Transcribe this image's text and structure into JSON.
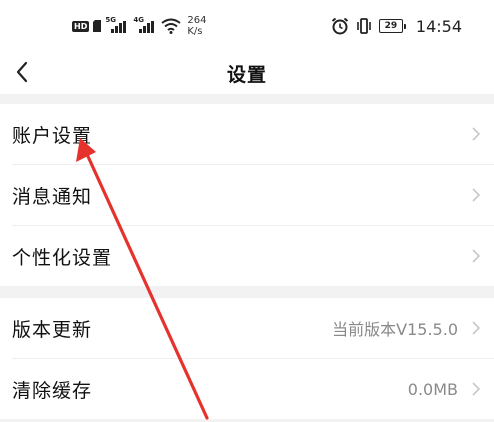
{
  "status_bar": {
    "hd_badge": "HD",
    "net1_label": "5G",
    "net2_label": "4G",
    "speed_value": "264",
    "speed_unit": "K/s",
    "battery_level": "29",
    "time": "14:54"
  },
  "header": {
    "title": "设置"
  },
  "settings": {
    "items": [
      {
        "label": "账户设置",
        "value": ""
      },
      {
        "label": "消息通知",
        "value": ""
      },
      {
        "label": "个性化设置",
        "value": ""
      },
      {
        "label": "版本更新",
        "value": "当前版本V15.5.0"
      },
      {
        "label": "清除缓存",
        "value": "0.0MB"
      }
    ]
  },
  "colors": {
    "background": "#ffffff",
    "section_gap": "#f2f2f2",
    "text_primary": "#111111",
    "text_secondary": "#8a8a8a",
    "chevron": "#c8c8c8",
    "annotation_arrow": "#e5322d"
  },
  "icons": {
    "back": "chevron-left-icon",
    "row_arrow": "chevron-right-icon",
    "alarm": "alarm-icon",
    "vibrate": "vibrate-icon",
    "wifi": "wifi-icon"
  }
}
